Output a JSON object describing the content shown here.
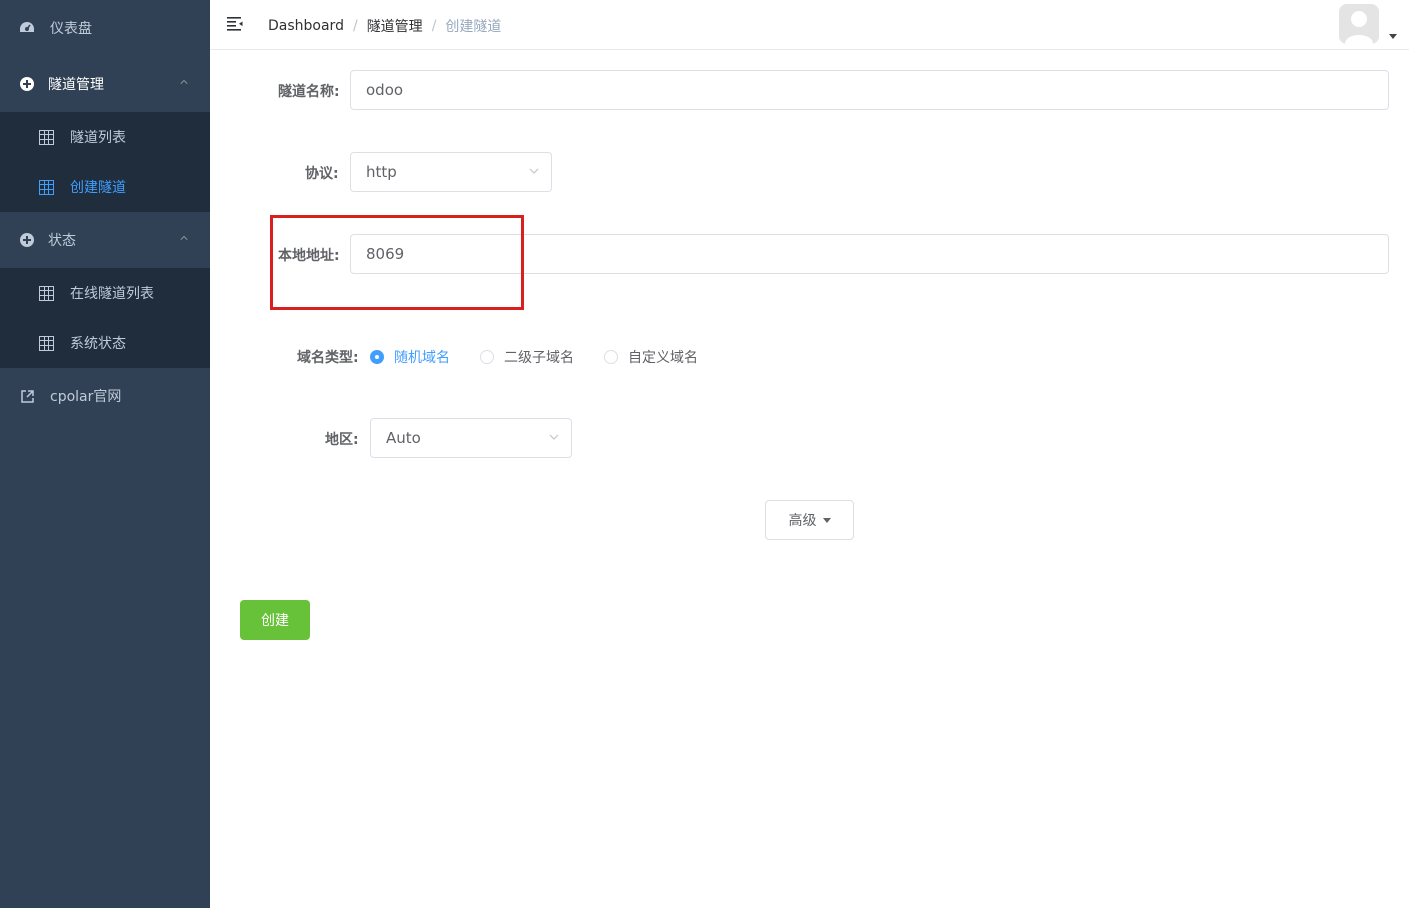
{
  "sidebar": {
    "dashboard": "仪表盘",
    "tunnel_mgmt": "隧道管理",
    "tunnel_list": "隧道列表",
    "create_tunnel": "创建隧道",
    "status": "状态",
    "online_tunnels": "在线隧道列表",
    "system_status": "系统状态",
    "cpolar_site": "cpolar官网"
  },
  "header": {
    "breadcrumb": [
      "Dashboard",
      "隧道管理",
      "创建隧道"
    ],
    "separator": "/"
  },
  "form": {
    "name_label": "隧道名称:",
    "name_value": "odoo",
    "protocol_label": "协议:",
    "protocol_value": "http",
    "local_addr_label": "本地地址:",
    "local_addr_value": "8069",
    "domain_type_label": "域名类型:",
    "domain_options": [
      "随机域名",
      "二级子域名",
      "自定义域名"
    ],
    "domain_selected": "随机域名",
    "region_label": "地区:",
    "region_value": "Auto",
    "advanced_label": "高级",
    "create_label": "创建"
  },
  "colors": {
    "sidebar_bg": "#304156",
    "submenu_bg": "#1f2d3d",
    "active": "#409eff",
    "create_button": "#67c23a",
    "highlight": "#d9201f"
  }
}
